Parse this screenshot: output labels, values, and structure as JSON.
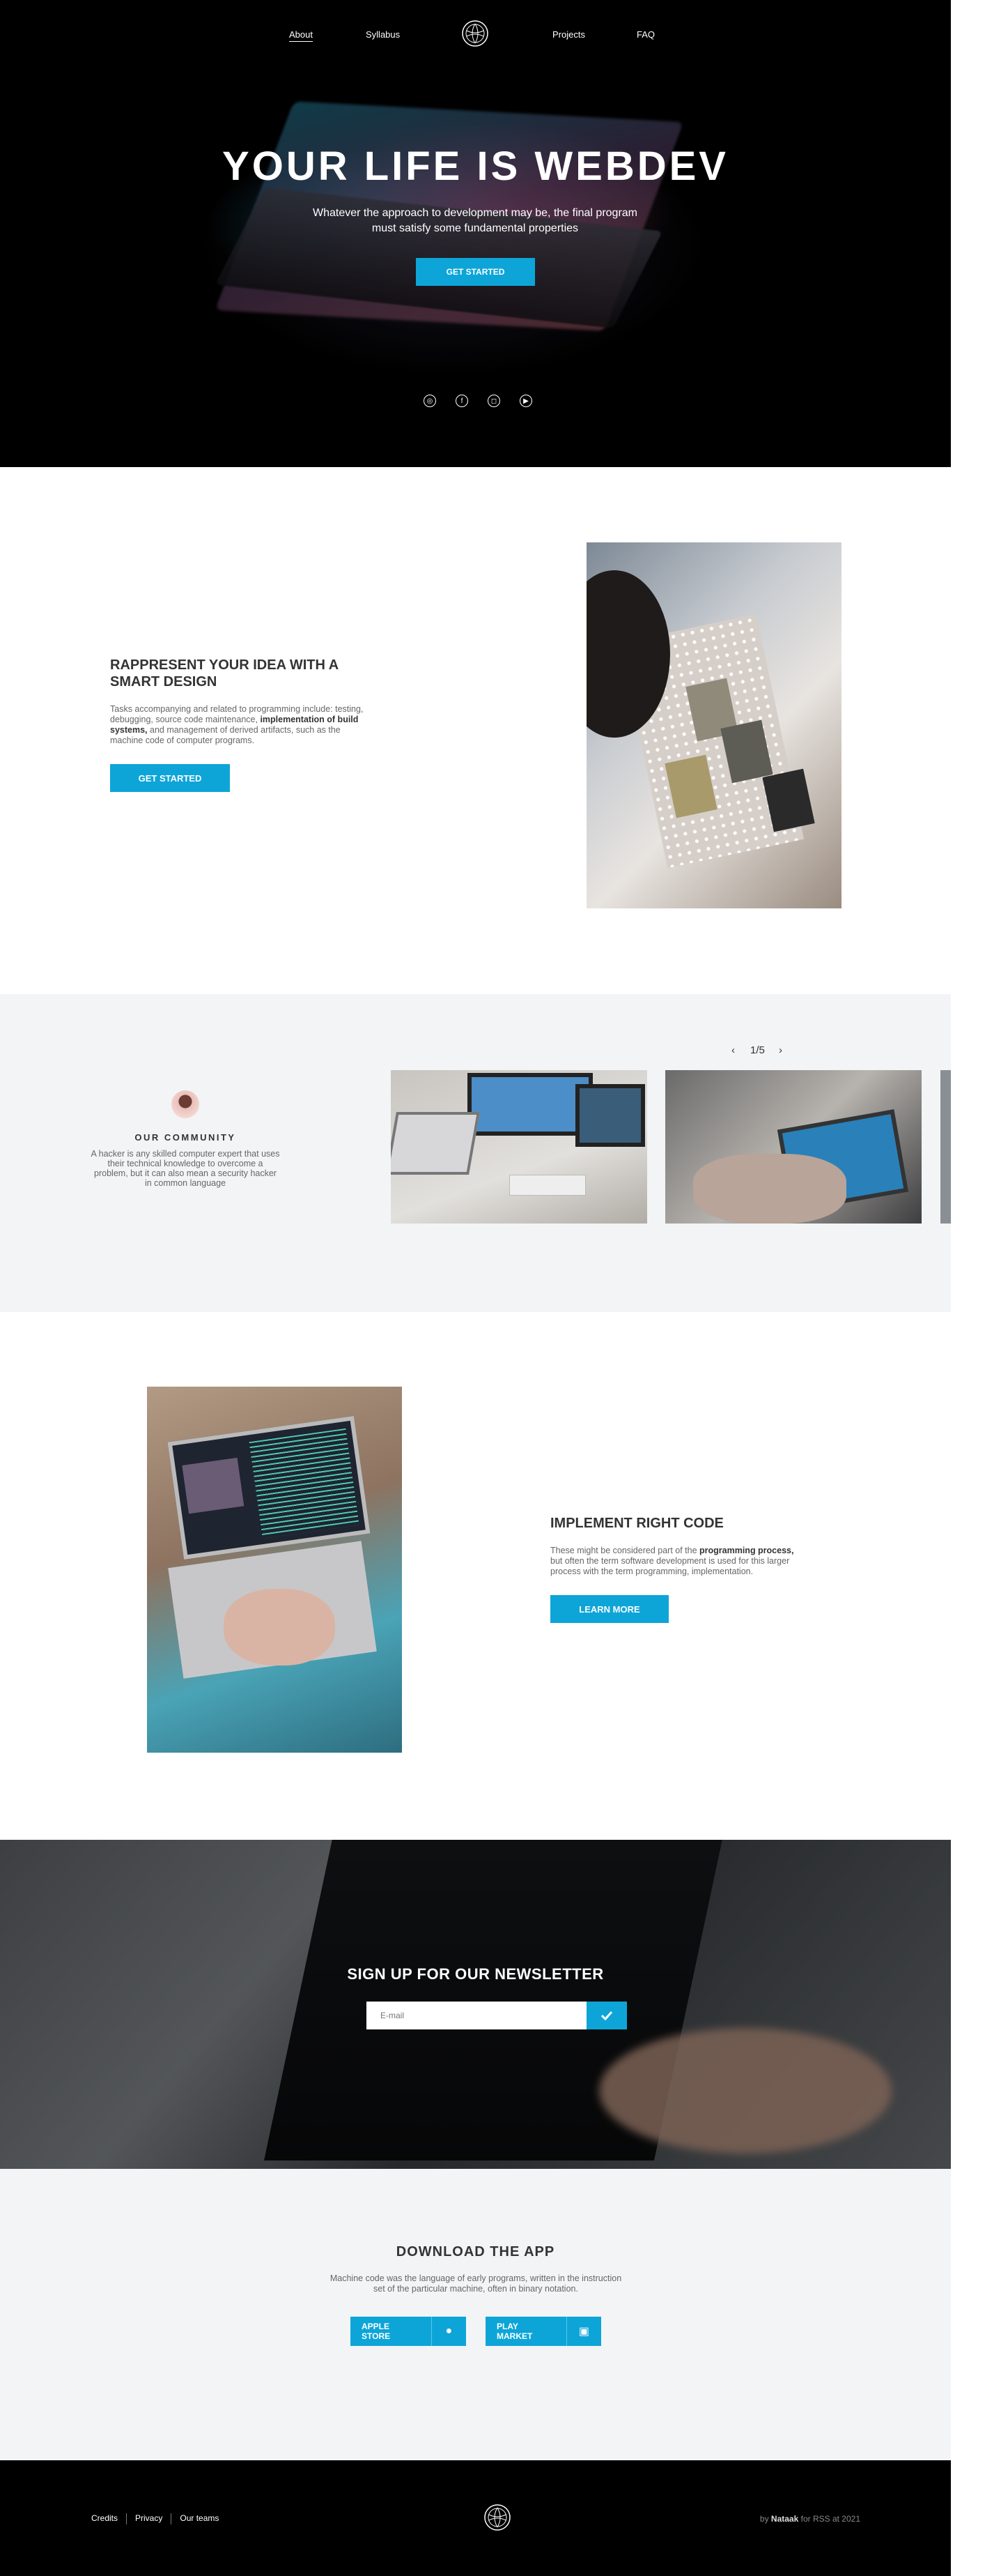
{
  "nav": {
    "about": "About",
    "syllabus": "Syllabus",
    "projects": "Projects",
    "faq": "FAQ"
  },
  "hero": {
    "title": "YOUR LIFE IS WEBDEV",
    "subtitle": "Whatever the approach to development may be, the final program must satisfy some fundamental properties",
    "cta": "GET STARTED",
    "socials": [
      "dribbble-icon",
      "facebook-icon",
      "instagram-icon",
      "youtube-icon"
    ]
  },
  "about": {
    "title": "RAPPRESENT YOUR IDEA WITH A SMART DESIGN",
    "text_before": "Tasks accompanying and related to programming include: testing, debugging, source code maintenance, ",
    "text_bold": "implementation of build systems,",
    "text_after": " and management of derived artifacts, such as the machine code of computer programs.",
    "cta": "GET STARTED"
  },
  "community": {
    "title": "OUR COMMUNITY",
    "text": "A hacker is any skilled computer expert that uses their technical knowledge to overcome a problem, but it can also mean a security hacker in common language",
    "pager": "1/5",
    "prev": "‹",
    "next": "›"
  },
  "code": {
    "title": "IMPLEMENT RIGHT CODE",
    "text_before": "These might be considered part of the ",
    "text_bold": "programming process,",
    "text_after": " but often the term software development is used for this larger process with the term programming, implementation.",
    "cta": "LEARN MORE"
  },
  "newsletter": {
    "title": "SIGN UP FOR OUR NEWSLETTER",
    "placeholder": "E-mail"
  },
  "app": {
    "title": "DOWNLOAD THE APP",
    "text": "Machine code was the language of early programs, written in the instruction set of the particular machine, often in binary notation.",
    "apple": "APPLE STORE",
    "play": "PLAY MARKET"
  },
  "footer": {
    "links": [
      "Credits",
      "Privacy",
      "Our teams"
    ],
    "credit_prefix": "by ",
    "credit_name": "Nataak",
    "credit_suffix": " for RSS at 2021"
  },
  "colors": {
    "accent": "#0da5d8",
    "dark": "#000000",
    "light_bg": "#f3f4f6"
  }
}
